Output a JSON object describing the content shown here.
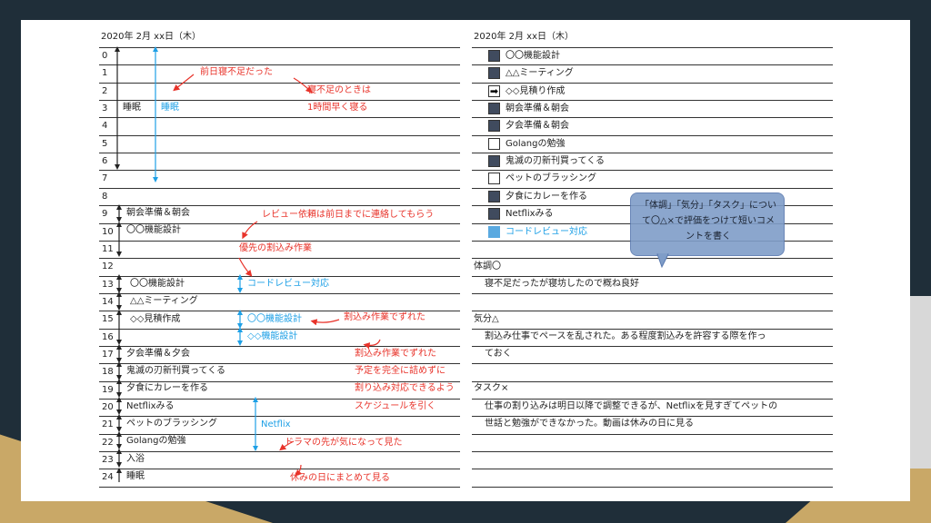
{
  "left": {
    "date": "2020年 2月 xx日（木）",
    "hours": [
      "0",
      "1",
      "2",
      "3",
      "4",
      "5",
      "6",
      "7",
      "8",
      "9",
      "10",
      "11",
      "12",
      "13",
      "14",
      "15",
      "16",
      "17",
      "18",
      "19",
      "20",
      "21",
      "22",
      "23",
      "24"
    ],
    "activities": {
      "sleep": "睡眠",
      "sleep_plan": "睡眠",
      "h9": "朝会準備＆朝会",
      "h10": "〇〇機能設計",
      "h13": "〇〇機能設計",
      "h14": "△△ミーティング",
      "h15": "◇◇見積作成",
      "h17": "夕会準備＆夕会",
      "h18": "鬼滅の刃新刊買ってくる",
      "h19": "夕食にカレーを作る",
      "h20": "Netflixみる",
      "h21": "ペットのブラッシング",
      "h22": "Golangの勉強",
      "h23": "入浴",
      "h24": "睡眠"
    },
    "plan_blue": {
      "h13": "コードレビュー対応",
      "h15": "〇〇機能設計",
      "h16": "◇◇機能設計",
      "netflix": "Netflix"
    },
    "notes": {
      "n1": "前日寝不足だった",
      "n2": "寝不足のときは",
      "n3": "1時間早く寝る",
      "n4": "レビュー依頼は前日までに連絡してもらう",
      "n5": "優先の割込み作業",
      "n6": "割込み作業でずれた",
      "n7": "割込み作業でずれた",
      "n8": "予定を完全に詰めずに",
      "n9": "割り込み対応できるよう",
      "n10": "スケジュールを引く",
      "n11": "ドラマの先が気になって見た",
      "n12": "休みの日にまとめて見る"
    }
  },
  "right": {
    "date": "2020年 2月 xx日（木）",
    "tasks": [
      {
        "label": "〇〇機能設計",
        "state": "done"
      },
      {
        "label": "△△ミーティング",
        "state": "done"
      },
      {
        "label": "◇◇見積り作成",
        "state": "moved"
      },
      {
        "label": "朝会準備＆朝会",
        "state": "done"
      },
      {
        "label": "夕会準備＆朝会",
        "state": "done"
      },
      {
        "label": "Golangの勉強",
        "state": "open"
      },
      {
        "label": "鬼滅の刃新刊買ってくる",
        "state": "done"
      },
      {
        "label": "ペットのブラッシング",
        "state": "open"
      },
      {
        "label": "夕食にカレーを作る",
        "state": "done"
      },
      {
        "label": "Netflixみる",
        "state": "done"
      },
      {
        "label": "コードレビュー対応",
        "state": "interrupt"
      }
    ],
    "condition_title": "体調〇",
    "condition_text": "寝不足だったが寝坊したので概ね良好",
    "mood_title": "気分△",
    "mood_text_1": "割込み仕事でペースを乱された。ある程度割込みを許容する際を作っ",
    "mood_text_2": "ておく",
    "task_title": "タスク×",
    "task_text_1": "仕事の割り込みは明日以降で調整できるが、Netflixを見すぎてペットの",
    "task_text_2": "世話と勉強ができなかった。動画は休みの日に見る",
    "callout": "「体調」「気分」「タスク」について〇△×で評価をつけて短いコメントを書く"
  },
  "colors": {
    "red": "#e8332a",
    "blue": "#1ea0e6",
    "dark_box": "#404b5e",
    "callout": "#7f9dc8"
  }
}
